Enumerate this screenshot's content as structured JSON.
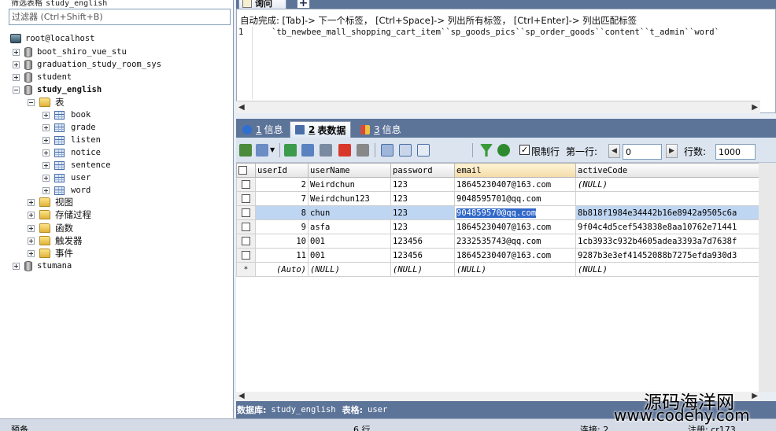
{
  "left_panel": {
    "filter_caption": "筛选表格",
    "filter_db": "study_english",
    "filter_placeholder": "过滤器 (Ctrl+Shift+B)",
    "server": "root@localhost",
    "databases": [
      "boot_shiro_vue_stu",
      "graduation_study_room_sys",
      "student",
      "study_english"
    ],
    "tables_folder": "表",
    "tables": [
      "book",
      "grade",
      "listen",
      "notice",
      "sentence",
      "user",
      "word"
    ],
    "folders": [
      "视图",
      "存储过程",
      "函数",
      "触发器",
      "事件"
    ],
    "last_database": "stumana"
  },
  "query": {
    "tab_label": "询问",
    "new_tab": "+",
    "autocomplete_hint": "自动完成:  [Tab]-> 下一个标签，  [Ctrl+Space]-> 列出所有标签，  [Ctrl+Enter]-> 列出匹配标签",
    "line_number": "1",
    "code_line": "`tb_newbee_mall_shopping_cart_item``sp_goods_pics``sp_order_goods``content``t_admin``word`"
  },
  "result_tabs": [
    {
      "num": "1",
      "label": "信息",
      "color": "#2f6fd0"
    },
    {
      "num": "2",
      "label": "表数据",
      "color": "#4a6fa8"
    },
    {
      "num": "3",
      "label": "信息",
      "color": "#d84a3a"
    }
  ],
  "toolbar": {
    "limit_label": "限制行",
    "first_row_label": "第一行:",
    "first_row_value": "0",
    "row_count_label": "行数:",
    "row_count_value": "1000",
    "limit_checked": "✓"
  },
  "grid": {
    "columns": [
      "userId",
      "userName",
      "password",
      "email",
      "activeCode"
    ],
    "rows": [
      [
        "2",
        "Weirdchun",
        "123",
        "18645230407@163.com",
        "(NULL)"
      ],
      [
        "7",
        "Weirdchun123",
        "123",
        "9048595701@qq.com",
        ""
      ],
      [
        "8",
        "chun",
        "123",
        "904859570@qq.com",
        "8b818f1984e34442b16e8942a9505c6a"
      ],
      [
        "9",
        "asfa",
        "123",
        "18645230407@163.com",
        "9f04c4d5cef543838e8aa10762e71441"
      ],
      [
        "10",
        "001",
        "123456",
        "2332535743@qq.com",
        "1cb3933c932b4605adea3393a7d7638f"
      ],
      [
        "11",
        "001",
        "123456",
        "18645230407@163.com",
        "9287b3e3ef41452088b7275efda930d3"
      ],
      [
        "(Auto)",
        "(NULL)",
        "(NULL)",
        "(NULL)",
        "(NULL)"
      ]
    ],
    "new_row_marker": "*"
  },
  "info_bar": {
    "db_label": "数据库:",
    "db_value": "study_english",
    "table_label": "表格:",
    "table_value": "user"
  },
  "status_bar": {
    "left": "预备",
    "rows": "6 行",
    "connection": "连接: 2",
    "register": "注册:  cr173"
  },
  "watermark": {
    "cn": "源码海洋网",
    "url": "www.codehy.com"
  }
}
